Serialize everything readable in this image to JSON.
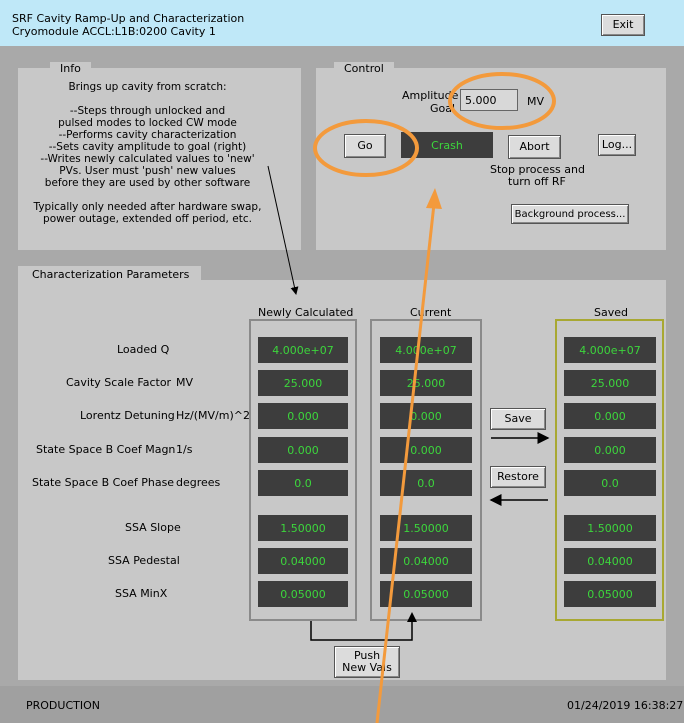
{
  "header": {
    "title": "SRF Cavity Ramp-Up and Characterization",
    "subtitle": "Cryomodule ACCL:L1B:0200 Cavity 1",
    "exit_label": "Exit"
  },
  "info": {
    "tab_label": "Info",
    "lines": [
      "Brings up cavity from scratch:",
      "",
      "--Steps through unlocked and",
      "pulsed modes to locked CW mode",
      "--Performs cavity characterization",
      "--Sets cavity amplitude to goal (right)",
      "--Writes newly calculated values to 'new'",
      "PVs. User must 'push' new values",
      "before they are used by other software",
      "",
      "Typically only needed after hardware swap,",
      "power outage, extended off period, etc."
    ]
  },
  "control": {
    "tab_label": "Control",
    "amplitude_label_1": "Amplitude",
    "amplitude_label_2": "Goal",
    "amplitude_value": "5.000",
    "amplitude_unit": "MV",
    "go_label": "Go",
    "status_text": "Crash",
    "abort_label": "Abort",
    "log_label": "Log...",
    "stop_note_1": "Stop process and",
    "stop_note_2": "turn off RF",
    "background_label": "Background process..."
  },
  "characterization": {
    "tab_label": "Characterization Parameters",
    "col_newly": "Newly Calculated",
    "col_current": "Current",
    "col_saved": "Saved",
    "rows": [
      {
        "label": "Loaded Q",
        "unit": "",
        "newly": "4.000e+07",
        "current": "4.000e+07",
        "saved": "4.000e+07"
      },
      {
        "label": "Cavity Scale Factor",
        "unit": "MV",
        "newly": "25.000",
        "current": "25.000",
        "saved": "25.000"
      },
      {
        "label": "Lorentz Detuning",
        "unit": "Hz/(MV/m)^2",
        "newly": "0.000",
        "current": "0.000",
        "saved": "0.000"
      },
      {
        "label": "State Space B Coef Magn",
        "unit": "1/s",
        "newly": "0.000",
        "current": "0.000",
        "saved": "0.000"
      },
      {
        "label": "State Space B Coef Phase",
        "unit": "degrees",
        "newly": "0.0",
        "current": "0.0",
        "saved": "0.0"
      },
      {
        "label": "SSA Slope",
        "unit": "",
        "newly": "1.50000",
        "current": "1.50000",
        "saved": "1.50000"
      },
      {
        "label": "SSA Pedestal",
        "unit": "",
        "newly": "0.04000",
        "current": "0.04000",
        "saved": "0.04000"
      },
      {
        "label": "SSA MinX",
        "unit": "",
        "newly": "0.05000",
        "current": "0.05000",
        "saved": "0.05000"
      }
    ],
    "save_label": "Save",
    "restore_label": "Restore",
    "push_label_1": "Push",
    "push_label_2": "New Vals"
  },
  "footer": {
    "mode": "PRODUCTION",
    "timestamp": "01/24/2019 16:38:27"
  },
  "colors": {
    "header_bg": "#bfe8f8",
    "field_bg": "#3d3d3d",
    "field_text": "#3cd63c",
    "annotation": "#f39a3c",
    "saved_border": "#a8a832"
  }
}
